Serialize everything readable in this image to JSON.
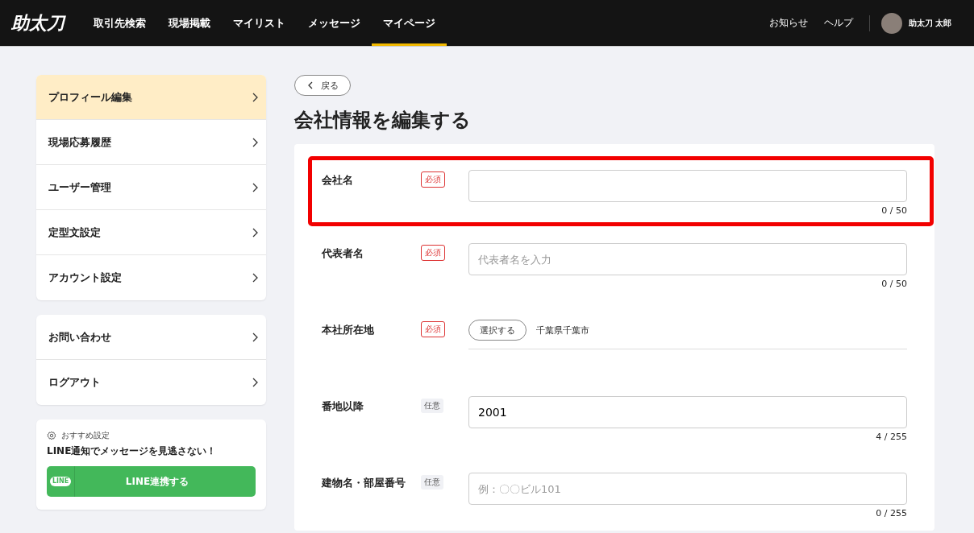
{
  "header": {
    "logo": "助太刀",
    "nav": [
      {
        "label": "取引先検索",
        "selected": false
      },
      {
        "label": "現場掲載",
        "selected": false
      },
      {
        "label": "マイリスト",
        "selected": false
      },
      {
        "label": "メッセージ",
        "selected": false
      },
      {
        "label": "マイページ",
        "selected": true
      }
    ],
    "links": [
      "お知らせ",
      "ヘルプ"
    ],
    "user_name": "助太刀 太郎"
  },
  "sidebar": {
    "menu_groups": [
      [
        {
          "label": "プロフィール編集",
          "selected": true
        },
        {
          "label": "現場応募履歴",
          "selected": false
        },
        {
          "label": "ユーザー管理",
          "selected": false
        },
        {
          "label": "定型文設定",
          "selected": false
        },
        {
          "label": "アカウント設定",
          "selected": false
        }
      ],
      [
        {
          "label": "お問い合わせ",
          "selected": false
        },
        {
          "label": "ログアウト",
          "selected": false
        }
      ]
    ],
    "promo": {
      "caption": "おすすめ設定",
      "message": "LINE通知でメッセージを見逃さない！",
      "button": "LINE連携する",
      "button_icon_text": "LINE"
    }
  },
  "back_button": "戻る",
  "title": "会社情報を編集する",
  "fields": [
    {
      "kind": "text",
      "label": "会社名",
      "required": true,
      "badge": "必須",
      "counter": "0 / 50",
      "highlighted": true
    },
    {
      "kind": "text",
      "label": "代表者名",
      "required": true,
      "badge": "必須",
      "placeholder": "代表者名を入力",
      "counter": "0 / 50",
      "highlighted": false
    },
    {
      "kind": "select",
      "label": "本社所在地",
      "required": true,
      "badge": "必須",
      "button": "選択する",
      "value": "千葉県千葉市",
      "highlighted": false
    },
    {
      "kind": "text",
      "label": "番地以降",
      "required": false,
      "badge": "任意",
      "value": "2001",
      "counter": "4 / 255",
      "highlighted": false
    },
    {
      "kind": "text",
      "label": "建物名・部屋番号",
      "required": false,
      "badge": "任意",
      "placeholder": "例：〇〇ビル101",
      "counter": "0 / 255",
      "highlighted": false
    }
  ]
}
